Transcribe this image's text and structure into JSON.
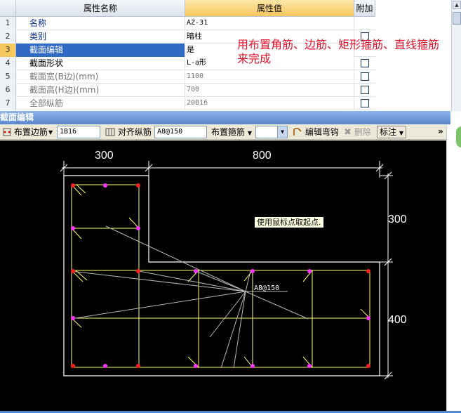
{
  "grid": {
    "headers": {
      "name": "属性名称",
      "value": "属性值",
      "extra": "附加"
    },
    "rows": [
      {
        "num": "1",
        "name": "名称",
        "value": "AZ-31",
        "check": false
      },
      {
        "num": "2",
        "name": "类别",
        "value": "暗柱",
        "check": true
      },
      {
        "num": "3",
        "name": "截面编辑",
        "value": "是",
        "check": false
      },
      {
        "num": "4",
        "name": "截面形状",
        "value": "L-a形",
        "check": true
      },
      {
        "num": "5",
        "name": "截面宽(B边)(mm)",
        "value": "1100",
        "check": true
      },
      {
        "num": "6",
        "name": "截面高(H边)(mm)",
        "value": "700",
        "check": true
      },
      {
        "num": "7",
        "name": "全部纵筋",
        "value": "20B16",
        "check": true
      }
    ],
    "scroll_up": "▲"
  },
  "note": "用布置角筋、边筋、矩形箍筋、直线箍筋来完成",
  "panel": {
    "title": "截面编辑",
    "toolbar": {
      "place_edge_bar": "布置边筋",
      "edge_bar_value": "1B16",
      "align_longitudinal": "对齐纵筋",
      "stirrup_value": "A8@150",
      "place_stirrup": "布置箍筋",
      "stirrup_type_value": "",
      "edit_hook": "编辑弯钩",
      "delete": "删除",
      "annotate": "标注",
      "more": "»"
    }
  },
  "drawing": {
    "dims": {
      "top_left": "300",
      "top_right": "800",
      "right_top": "300",
      "right_bottom": "400"
    },
    "leader_label": "A8@150",
    "tooltip": "使用鼠标点取起点."
  },
  "colors": {
    "outline": "#ffffff",
    "stirrup": "#ffff66",
    "corner_bar": "#ff2020",
    "edge_bar": "#ff33ff",
    "selection": "#316ac5",
    "note_text": "#e4122a"
  }
}
